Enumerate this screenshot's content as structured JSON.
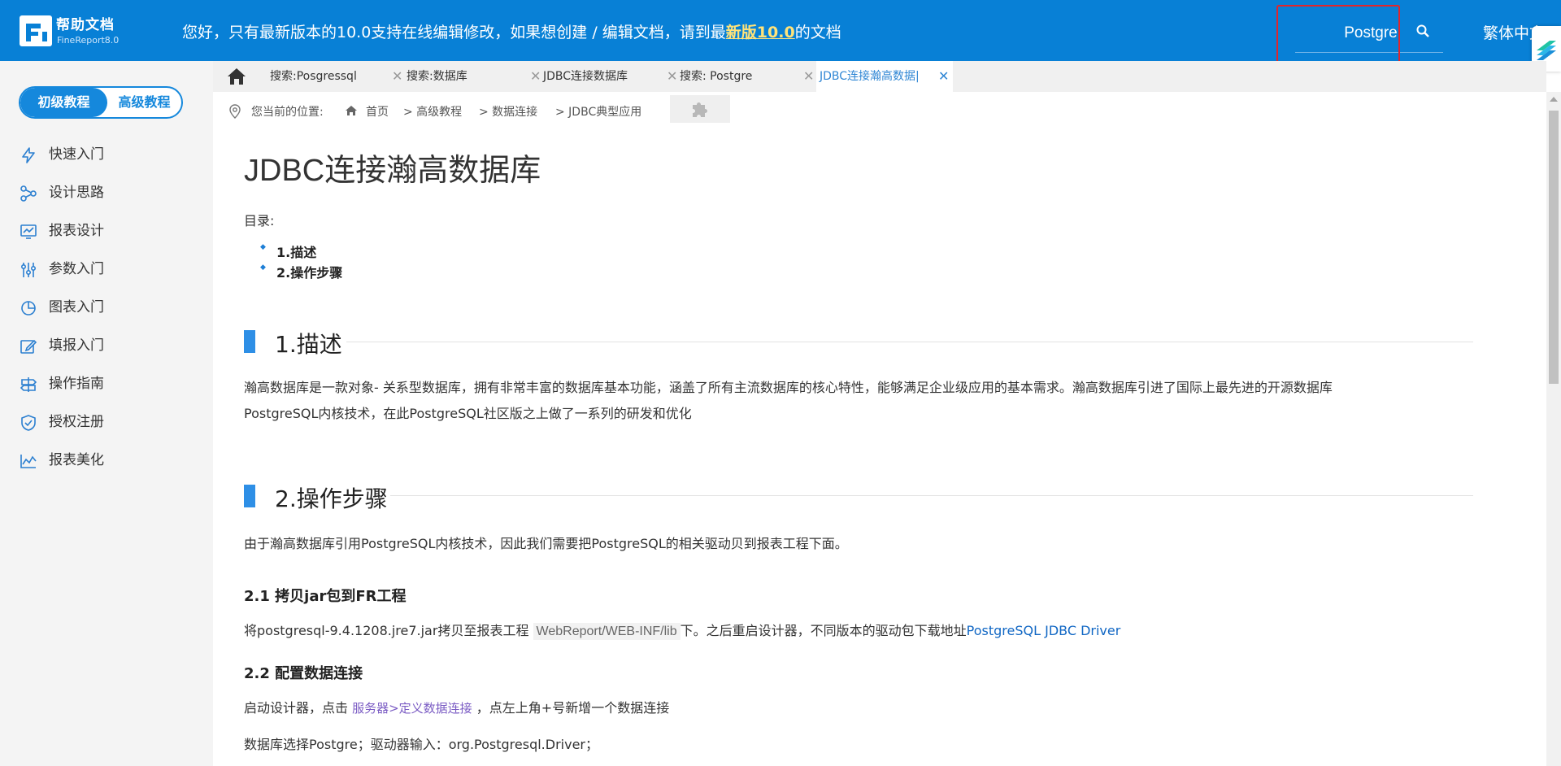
{
  "header": {
    "logo_title": "帮助文档",
    "logo_subtitle": "FineReport8.0",
    "banner_prefix": "您好，只有最新版本的10.0支持在线编辑修改，如果想创建 / 编辑文档，请到最",
    "banner_highlight": "新版10.0",
    "banner_suffix": "的文档",
    "search_value": "Postgre",
    "lang_switch": "繁体中文"
  },
  "sidebar": {
    "level_primary": "初级教程",
    "level_advanced": "高级教程",
    "items": [
      {
        "label": "快速入门",
        "icon": "lightning-icon"
      },
      {
        "label": "设计思路",
        "icon": "network-icon"
      },
      {
        "label": "报表设计",
        "icon": "monitor-chart-icon"
      },
      {
        "label": "参数入门",
        "icon": "sliders-icon"
      },
      {
        "label": "图表入门",
        "icon": "pie-chart-icon"
      },
      {
        "label": "填报入门",
        "icon": "edit-icon"
      },
      {
        "label": "操作指南",
        "icon": "signpost-icon"
      },
      {
        "label": "授权注册",
        "icon": "shield-check-icon"
      },
      {
        "label": "报表美化",
        "icon": "line-chart-icon"
      }
    ]
  },
  "tabs": [
    {
      "label": "搜索:Posgressql"
    },
    {
      "label": "搜索:数据库"
    },
    {
      "label": "JDBC连接数据库"
    },
    {
      "label": "搜索: Postgre"
    },
    {
      "label": "JDBC连接瀚高数据|"
    }
  ],
  "breadcrumb": {
    "prefix": "您当前的位置:",
    "items": [
      "首页",
      "> 高级教程",
      "> 数据连接",
      "> JDBC典型应用"
    ]
  },
  "article": {
    "title": "JDBC连接瀚高数据库",
    "toc_label": "目录:",
    "toc": [
      "1.描述",
      "2.操作步骤"
    ],
    "section1_title": "1.描述",
    "section1_p1": "瀚高数据库是一款对象- 关系型数据库，拥有非常丰富的数据库基本功能，涵盖了所有主流数据库的核心特性，能够满足企业级应用的基本需求。瀚高数据库引进了国际上最先进的开源数据库",
    "section1_p2": "PostgreSQL内核技术，在此PostgreSQL社区版之上做了一系列的研发和优化",
    "section2_title": "2.操作步骤",
    "section2_p1": "由于瀚高数据库引用PostgreSQL内核技术，因此我们需要把PostgreSQL的相关驱动贝到报表工程下面。",
    "sub1_title": "2.1 拷贝jar包到FR工程",
    "sub1_text_a": "将postgresql-9.4.1208.jre7.jar拷贝至报表工程",
    "sub1_code": "WebReport/WEB-INF/lib",
    "sub1_text_b": "下。之后重启设计器，不同版本的驱动包下载地址",
    "sub1_link": "PostgreSQL JDBC Driver",
    "sub2_title": "2.2 配置数据连接",
    "sub2_text_a": "启动设计器，点击",
    "sub2_menu": "服务器>定义数据连接",
    "sub2_text_b": "，点左上角+号新增一个数据连接",
    "sub2_p2": "数据库选择Postgre；驱动器输入：org.Postgresql.Driver；"
  },
  "colors": {
    "header_bg": "#0880d6",
    "accent": "#1588dc",
    "annotation": "#e3252a",
    "link": "#1167c4"
  }
}
